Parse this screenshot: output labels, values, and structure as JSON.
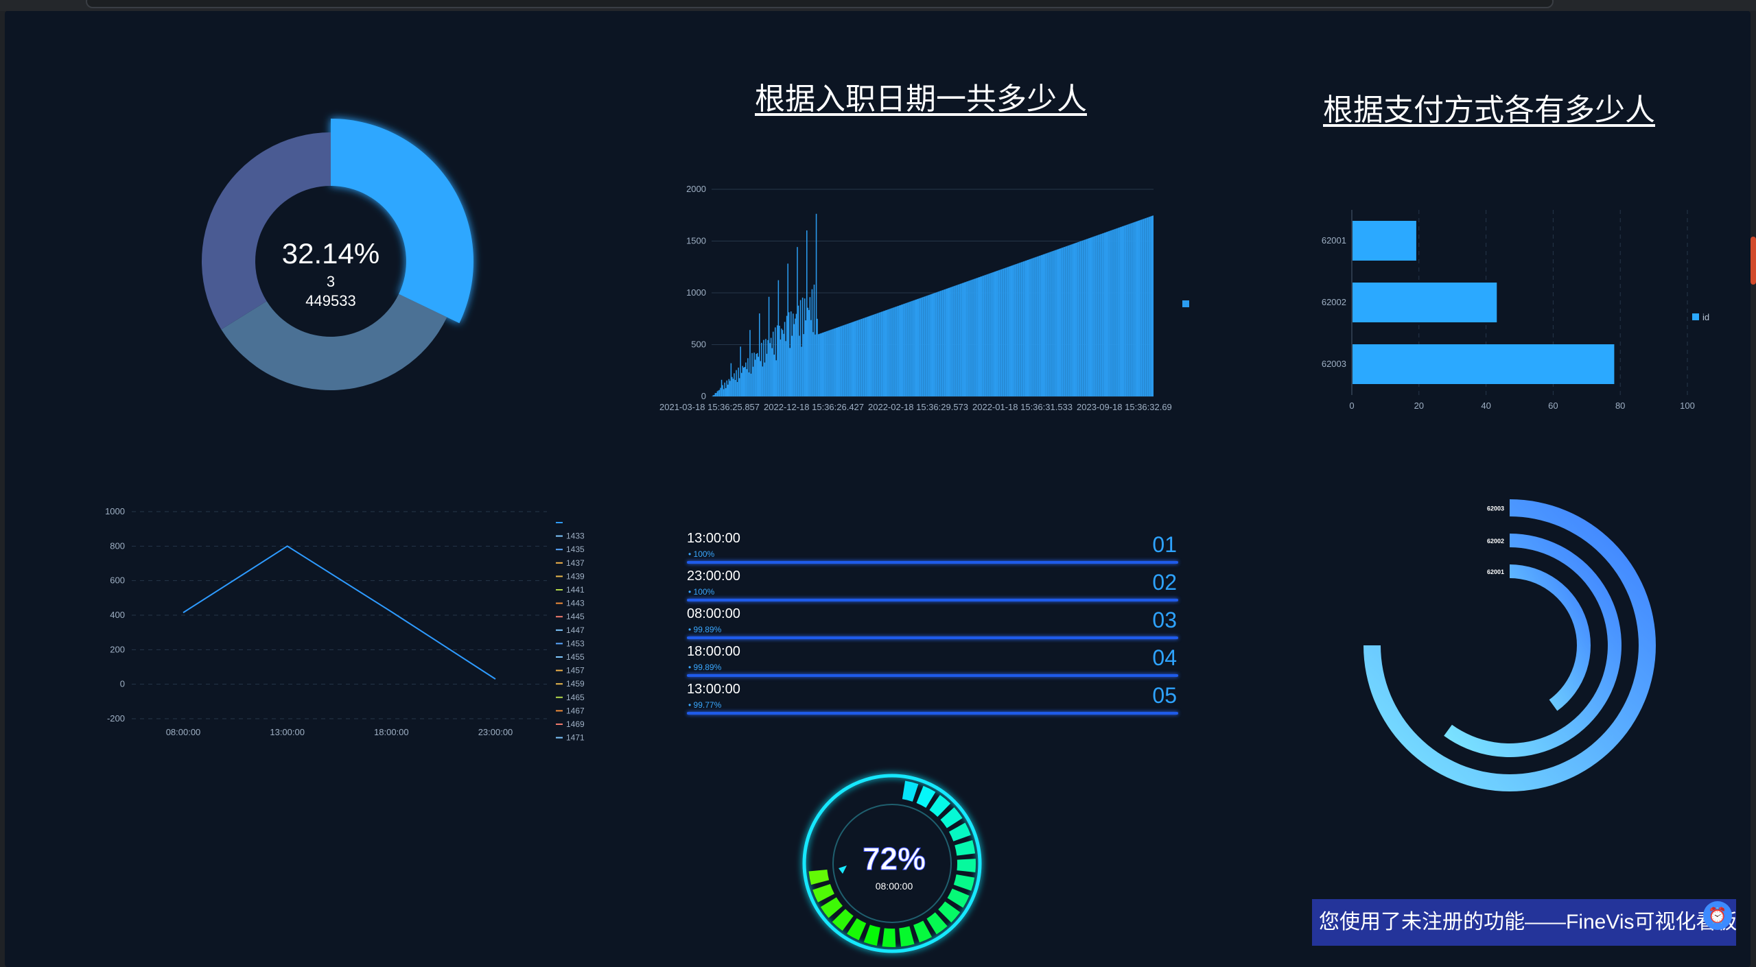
{
  "titles": {
    "hire_date": "根据入职日期一共多少人",
    "payment": "根据支付方式各有多少人"
  },
  "donut": {
    "percent_label": "32.14%",
    "count_label": "3",
    "value_label": "449533",
    "slices": [
      {
        "value": 32.14,
        "color": "#2ea7ff",
        "highlighted": true
      },
      {
        "value": 34.0,
        "color": "#4b7195"
      },
      {
        "value": 33.86,
        "color": "#4a5b93"
      }
    ]
  },
  "chart_data": [
    {
      "type": "bar",
      "title": "根据入职日期一共多少人",
      "ylim": [
        0,
        2000
      ],
      "yticks": [
        "0",
        "500",
        "1000",
        "1500",
        "2000"
      ],
      "xtick_labels": [
        "2021-03-18 15:36:25.857",
        "2022-12-18 15:36:26.427",
        "2022-02-18 15:36:29.573",
        "2022-01-18 15:36:31.533",
        "2023-09-18 15:36:32.69"
      ],
      "trend": {
        "start": 0,
        "early_peak": 1870,
        "ramp_start": 600,
        "end": 1750
      },
      "grid": true,
      "legend_position": "right",
      "color": "#2b9cf0"
    },
    {
      "type": "bar",
      "orientation": "horizontal",
      "title": "根据支付方式各有多少人",
      "categories": [
        "62001",
        "62002",
        "62003"
      ],
      "values": [
        19,
        43,
        78
      ],
      "xlim": [
        0,
        100
      ],
      "xticks": [
        "0",
        "20",
        "40",
        "60",
        "80",
        "100"
      ],
      "legend": [
        "id"
      ],
      "legend_position": "right",
      "color": "#2ba9ff"
    },
    {
      "type": "line",
      "x": [
        "08:00:00",
        "13:00:00",
        "18:00:00",
        "23:00:00"
      ],
      "values": [
        415,
        800,
        420,
        30
      ],
      "ylim": [
        -200,
        1000
      ],
      "yticks": [
        "-200",
        "0",
        "200",
        "400",
        "600",
        "800",
        "1000"
      ],
      "grid": true,
      "legend": [
        "",
        "1433",
        "1435",
        "1437",
        "1439",
        "1441",
        "1443",
        "1445",
        "1447",
        "1453",
        "1455",
        "1457",
        "1459",
        "1465",
        "1467",
        "1469",
        "1471"
      ],
      "legend_colors": [
        "#2e9bff",
        "#7fc8ff",
        "#5aa7ff",
        "#f0b24a",
        "#e8b84c",
        "#b3d84a",
        "#ef8c3a",
        "#f07a6c",
        "#7fc8ff",
        "#5aa7ff",
        "#7fc8ff",
        "#f0b24a",
        "#e8b84c",
        "#b3d84a",
        "#ef8c3a",
        "#f07a6c",
        "#7fc8ff"
      ],
      "legend_position": "right",
      "color": "#2e9bff"
    },
    {
      "type": "table",
      "rows": [
        {
          "time": "13:00:00",
          "pct": "• 100%",
          "rank": "01"
        },
        {
          "time": "23:00:00",
          "pct": "• 100%",
          "rank": "02"
        },
        {
          "time": "08:00:00",
          "pct": "• 99.89%",
          "rank": "03"
        },
        {
          "time": "18:00:00",
          "pct": "• 99.89%",
          "rank": "04"
        },
        {
          "time": "13:00:00",
          "pct": "• 99.77%",
          "rank": "05"
        }
      ]
    },
    {
      "type": "pie",
      "subtype": "radial-bar",
      "categories": [
        "62003",
        "62002",
        "62001"
      ],
      "values": [
        75,
        60,
        40
      ],
      "gradient": [
        "#3a7bff",
        "#7ee8ff"
      ]
    }
  ],
  "gauge": {
    "percent_label": "72%",
    "time_label": "08:00:00",
    "value": 72,
    "segments": 28
  },
  "notice": {
    "text": "您使用了未注册的功能——FineVis可视化看板",
    "icon": "alarm-icon"
  }
}
